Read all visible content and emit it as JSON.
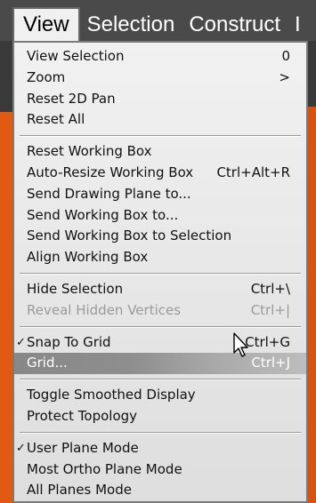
{
  "menubar": {
    "items": [
      {
        "label": "View",
        "active": true
      },
      {
        "label": "Selection",
        "active": false
      },
      {
        "label": "Construct",
        "active": false
      },
      {
        "label": "I",
        "active": false
      }
    ]
  },
  "menu": {
    "groups": [
      [
        {
          "label": "View Selection",
          "shortcut": "0"
        },
        {
          "label": "Zoom",
          "shortcut": ">"
        },
        {
          "label": "Reset 2D Pan",
          "shortcut": ""
        },
        {
          "label": "Reset All",
          "shortcut": ""
        }
      ],
      [
        {
          "label": "Reset Working Box",
          "shortcut": ""
        },
        {
          "label": "Auto-Resize Working Box",
          "shortcut": "Ctrl+Alt+R"
        },
        {
          "label": "Send Drawing Plane to...",
          "shortcut": ""
        },
        {
          "label": "Send Working Box to...",
          "shortcut": ""
        },
        {
          "label": "Send Working Box to Selection",
          "shortcut": ""
        },
        {
          "label": "Align Working Box",
          "shortcut": ""
        }
      ],
      [
        {
          "label": "Hide Selection",
          "shortcut": "Ctrl+\\"
        },
        {
          "label": "Reveal Hidden Vertices",
          "shortcut": "Ctrl+|",
          "disabled": true
        }
      ],
      [
        {
          "label": "Snap To Grid",
          "shortcut": "Ctrl+G",
          "checked": true
        },
        {
          "label": "Grid...",
          "shortcut": "Ctrl+J",
          "highlighted": true
        }
      ],
      [
        {
          "label": "Toggle Smoothed Display",
          "shortcut": ""
        },
        {
          "label": "Protect Topology",
          "shortcut": ""
        }
      ],
      [
        {
          "label": "User Plane Mode",
          "shortcut": "",
          "checked": true
        },
        {
          "label": "Most Ortho Plane Mode",
          "shortcut": ""
        },
        {
          "label": "All Planes Mode",
          "shortcut": ""
        }
      ]
    ]
  },
  "icons": {
    "check": "checkmark-icon",
    "cursor": "mouse-pointer-icon"
  },
  "colors": {
    "menu_bg": "#e8e8e8",
    "highlight": "#8e8e8e",
    "disabled_text": "#9a9a9a",
    "background_accent": "#e05a14"
  }
}
